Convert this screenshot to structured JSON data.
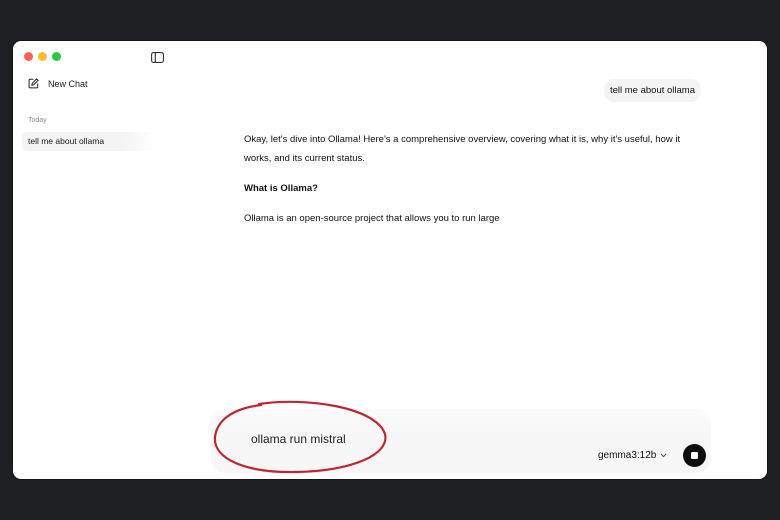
{
  "sidebar": {
    "new_chat_label": "New Chat",
    "section_label": "Today",
    "history": [
      {
        "label": "tell me about ollama"
      }
    ]
  },
  "conversation": {
    "user_message": "tell me about ollama",
    "assistant_paragraphs": [
      "Okay, let's dive into Ollama! Here's a comprehensive overview, covering what it is, why it's useful, how it works, and its current status.",
      "What is Ollama?",
      "Ollama is an open-source project that allows you to run large"
    ]
  },
  "composer": {
    "input_value": "ollama run mistral",
    "model": "gemma3:12b"
  },
  "colors": {
    "window_bg": "#ffffff",
    "desktop_bg": "#1e1f22",
    "annotation_circle": "#c0272d",
    "stop_button": "#0d0d0d"
  },
  "icons": {
    "sidebar_toggle": "sidebar-toggle-icon",
    "new_chat": "compose-icon",
    "model_dropdown": "chevron-down-icon",
    "stop": "stop-icon"
  }
}
